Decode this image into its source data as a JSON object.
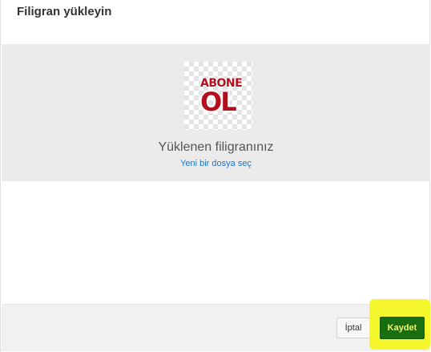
{
  "dialog": {
    "title": "Filigran yükleyin"
  },
  "upload": {
    "watermark_line1": "ABONE",
    "watermark_line2": "OL",
    "uploaded_label": "Yüklenen filigranınız",
    "new_file_link": "Yeni bir dosya seç"
  },
  "footer": {
    "cancel_label": "İptal",
    "save_label": "Kaydet"
  },
  "colors": {
    "save_button": "#1a6e12",
    "highlight": "#f6f62d",
    "link": "#1a73c8",
    "watermark": "#b50f1d"
  }
}
